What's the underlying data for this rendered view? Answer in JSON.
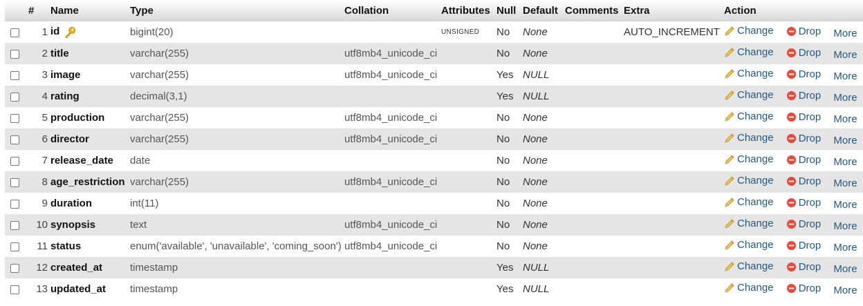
{
  "headers": {
    "num": "#",
    "name": "Name",
    "type": "Type",
    "collation": "Collation",
    "attributes": "Attributes",
    "null": "Null",
    "default": "Default",
    "comments": "Comments",
    "extra": "Extra",
    "action": "Action"
  },
  "actions": {
    "change": "Change",
    "drop": "Drop",
    "more": "More"
  },
  "colors": {
    "link": "#235a81",
    "drop": "#e8493b",
    "key": "#e6b422",
    "row_alt": "#e5e5e5"
  },
  "rows": [
    {
      "num": "1",
      "name": "id",
      "type": "bigint(20)",
      "collation": "",
      "attributes": "UNSIGNED",
      "null": "No",
      "default": "None",
      "comments": "",
      "extra": "AUTO_INCREMENT",
      "primary": true
    },
    {
      "num": "2",
      "name": "title",
      "type": "varchar(255)",
      "collation": "utf8mb4_unicode_ci",
      "attributes": "",
      "null": "No",
      "default": "None",
      "comments": "",
      "extra": ""
    },
    {
      "num": "3",
      "name": "image",
      "type": "varchar(255)",
      "collation": "utf8mb4_unicode_ci",
      "attributes": "",
      "null": "Yes",
      "default": "NULL",
      "comments": "",
      "extra": ""
    },
    {
      "num": "4",
      "name": "rating",
      "type": "decimal(3,1)",
      "collation": "",
      "attributes": "",
      "null": "Yes",
      "default": "NULL",
      "comments": "",
      "extra": ""
    },
    {
      "num": "5",
      "name": "production",
      "type": "varchar(255)",
      "collation": "utf8mb4_unicode_ci",
      "attributes": "",
      "null": "No",
      "default": "None",
      "comments": "",
      "extra": ""
    },
    {
      "num": "6",
      "name": "director",
      "type": "varchar(255)",
      "collation": "utf8mb4_unicode_ci",
      "attributes": "",
      "null": "No",
      "default": "None",
      "comments": "",
      "extra": ""
    },
    {
      "num": "7",
      "name": "release_date",
      "type": "date",
      "collation": "",
      "attributes": "",
      "null": "No",
      "default": "None",
      "comments": "",
      "extra": ""
    },
    {
      "num": "8",
      "name": "age_restriction",
      "type": "varchar(255)",
      "collation": "utf8mb4_unicode_ci",
      "attributes": "",
      "null": "No",
      "default": "None",
      "comments": "",
      "extra": ""
    },
    {
      "num": "9",
      "name": "duration",
      "type": "int(11)",
      "collation": "",
      "attributes": "",
      "null": "No",
      "default": "None",
      "comments": "",
      "extra": ""
    },
    {
      "num": "10",
      "name": "synopsis",
      "type": "text",
      "collation": "utf8mb4_unicode_ci",
      "attributes": "",
      "null": "No",
      "default": "None",
      "comments": "",
      "extra": ""
    },
    {
      "num": "11",
      "name": "status",
      "type": "enum('available', 'unavailable', 'coming_soon')",
      "collation": "utf8mb4_unicode_ci",
      "attributes": "",
      "null": "No",
      "default": "None",
      "comments": "",
      "extra": ""
    },
    {
      "num": "12",
      "name": "created_at",
      "type": "timestamp",
      "collation": "",
      "attributes": "",
      "null": "Yes",
      "default": "NULL",
      "comments": "",
      "extra": ""
    },
    {
      "num": "13",
      "name": "updated_at",
      "type": "timestamp",
      "collation": "",
      "attributes": "",
      "null": "Yes",
      "default": "NULL",
      "comments": "",
      "extra": ""
    }
  ]
}
